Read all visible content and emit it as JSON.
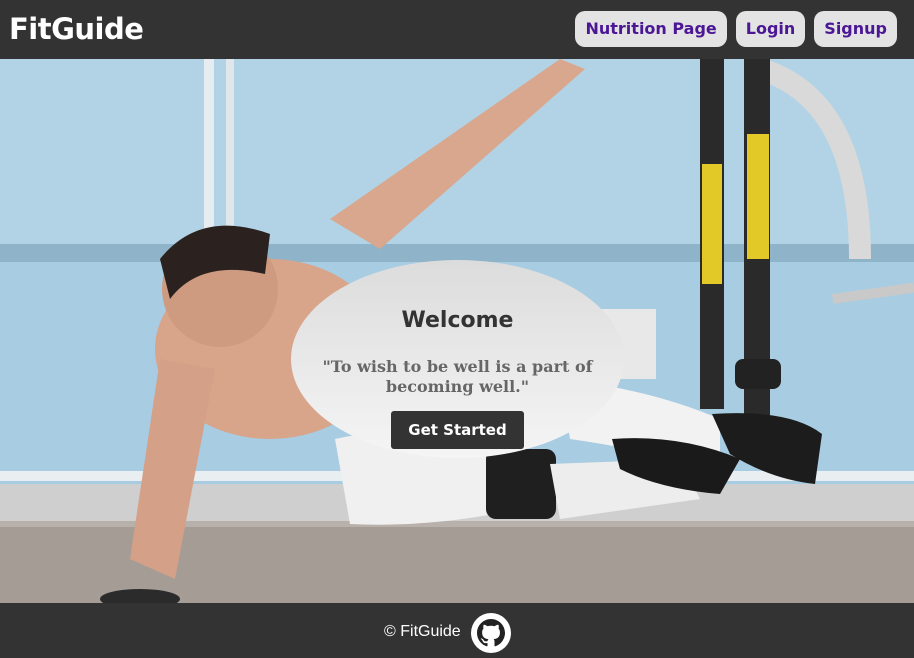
{
  "navbar": {
    "brand": "FitGuide",
    "links": [
      {
        "label": "Nutrition Page"
      },
      {
        "label": "Login"
      },
      {
        "label": "Signup"
      }
    ]
  },
  "hero": {
    "title": "Welcome",
    "quote": "\"To wish to be well is a part of becoming well.\"",
    "cta_label": "Get Started"
  },
  "footer": {
    "copyright": "© FitGuide",
    "icon": "github-icon"
  },
  "colors": {
    "bar": "#333333",
    "link_text": "#4b1795",
    "link_bg": "#e3e3e3",
    "hero_bg": "#a9cbe0"
  }
}
